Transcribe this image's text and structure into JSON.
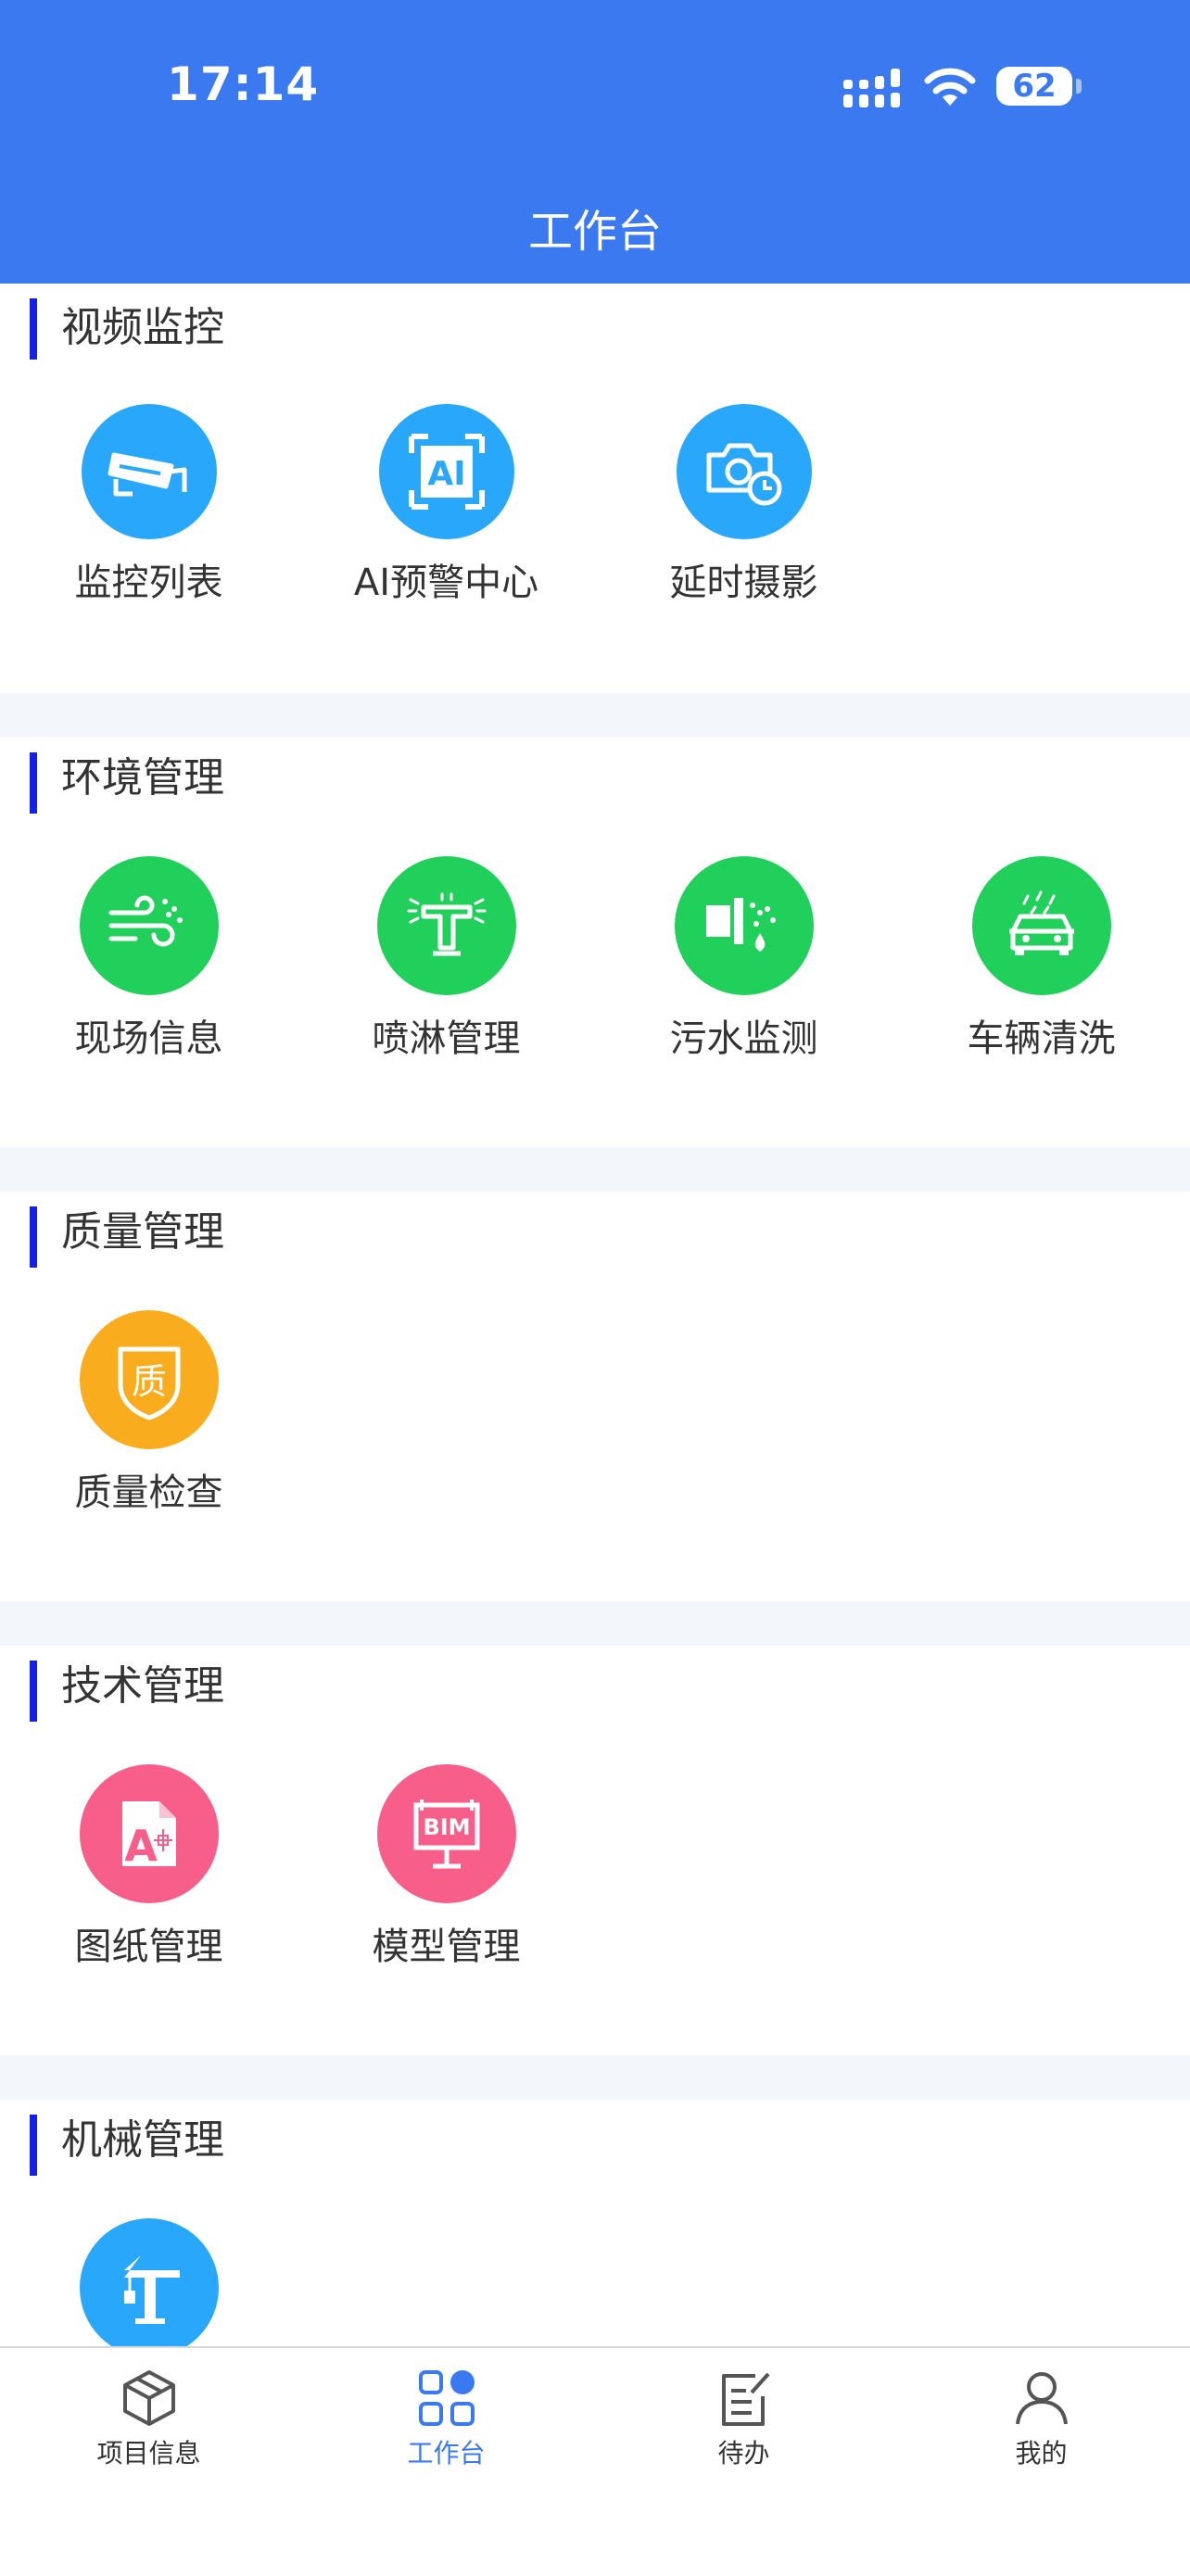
{
  "status_bar": {
    "time": "17:14",
    "battery": "62"
  },
  "nav": {
    "title": "工作台"
  },
  "colors": {
    "primary": "#3b79f1",
    "sky": "#29a7fb",
    "green": "#21d05a",
    "orange": "#f9ac1d",
    "pink": "#f75f8a",
    "section_bar": "#1421e8"
  },
  "sections": [
    {
      "title": "视频监控",
      "items": [
        {
          "label": "监控列表",
          "icon": "cctv-camera-icon"
        },
        {
          "label": "AI预警中心",
          "icon": "ai-icon"
        },
        {
          "label": "延时摄影",
          "icon": "timelapse-camera-icon"
        }
      ]
    },
    {
      "title": "环境管理",
      "items": [
        {
          "label": "现场信息",
          "icon": "wind-icon"
        },
        {
          "label": "喷淋管理",
          "icon": "sprinkler-icon"
        },
        {
          "label": "污水监测",
          "icon": "sewage-icon"
        },
        {
          "label": "车辆清洗",
          "icon": "car-wash-icon"
        }
      ]
    },
    {
      "title": "质量管理",
      "items": [
        {
          "label": "质量检查",
          "icon": "quality-shield-icon",
          "glyph": "质"
        }
      ]
    },
    {
      "title": "技术管理",
      "items": [
        {
          "label": "图纸管理",
          "icon": "drawing-icon",
          "glyph": "A"
        },
        {
          "label": "模型管理",
          "icon": "bim-model-icon",
          "glyph": "BIM"
        }
      ]
    },
    {
      "title": "机械管理",
      "items": [
        {
          "label": "",
          "icon": "tower-crane-icon"
        }
      ]
    }
  ],
  "tabs": [
    {
      "label": "项目信息",
      "icon": "cube-icon"
    },
    {
      "label": "工作台",
      "icon": "grid-icon",
      "active": true
    },
    {
      "label": "待办",
      "icon": "edit-document-icon"
    },
    {
      "label": "我的",
      "icon": "user-icon"
    }
  ]
}
